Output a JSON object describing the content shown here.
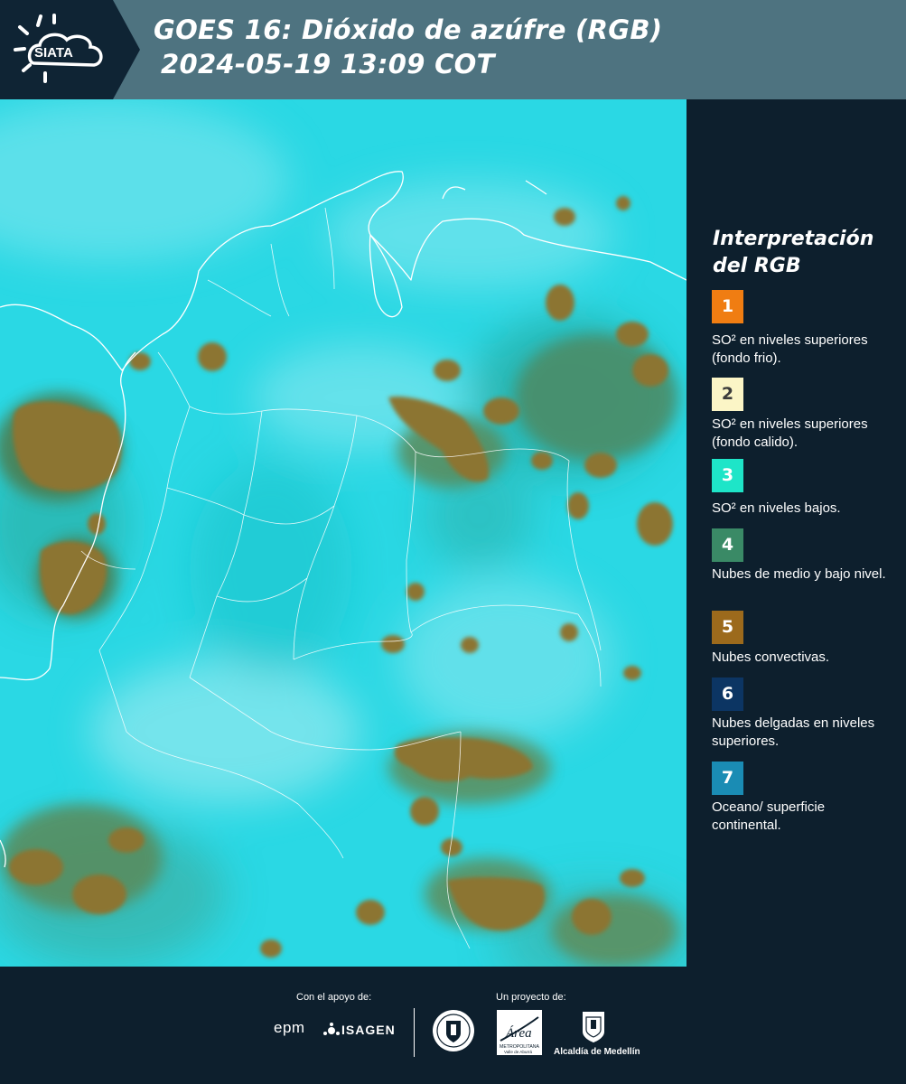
{
  "header": {
    "logo_text": "SIATA",
    "title_line1": "GOES 16: Dióxido de azúfre (RGB)",
    "title_line2": "2024-05-19 13:09 COT"
  },
  "legend": {
    "title": "Interpretación del RGB",
    "items": [
      {
        "number": "1",
        "color": "#f07d12",
        "text": "SO² en niveles superiores (fondo frio)."
      },
      {
        "number": "2",
        "color": "#fbf5c6",
        "text": "SO² en niveles superiores (fondo calido)."
      },
      {
        "number": "3",
        "color": "#1ee5c8",
        "text": "SO² en niveles bajos."
      },
      {
        "number": "4",
        "color": "#3a8a66",
        "text": "Nubes de medio y bajo nivel."
      },
      {
        "number": "5",
        "color": "#9c6a1c",
        "text": "Nubes convectivas."
      },
      {
        "number": "6",
        "color": "#0c3563",
        "text": "Nubes delgadas en niveles superiores."
      },
      {
        "number": "7",
        "color": "#1a8cb4",
        "text": "Oceano/ superficie continental."
      }
    ]
  },
  "footer": {
    "support_caption": "Con el apoyo de:",
    "project_caption": "Un proyecto de:",
    "sponsors": [
      "epm",
      "ISAGEN"
    ],
    "partners": [
      "Área Metropolitana Valle de Aburrá",
      "Alcaldía de Medellín"
    ],
    "partner_labels": {
      "area_big": "Área",
      "area_small": "METROPOLITANA",
      "area_sub": "Valle de Aburrá",
      "alcaldia": "Alcaldía de Medellín"
    }
  },
  "colors": {
    "header_bg": "#4e7380",
    "page_bg": "#0d1f2d",
    "cyan_surface": "#28d6e2",
    "cloud_brown": "#8c7430"
  },
  "icons": [
    "sun-icon",
    "cloud-icon",
    "seal-icon",
    "coat-of-arms-icon"
  ]
}
